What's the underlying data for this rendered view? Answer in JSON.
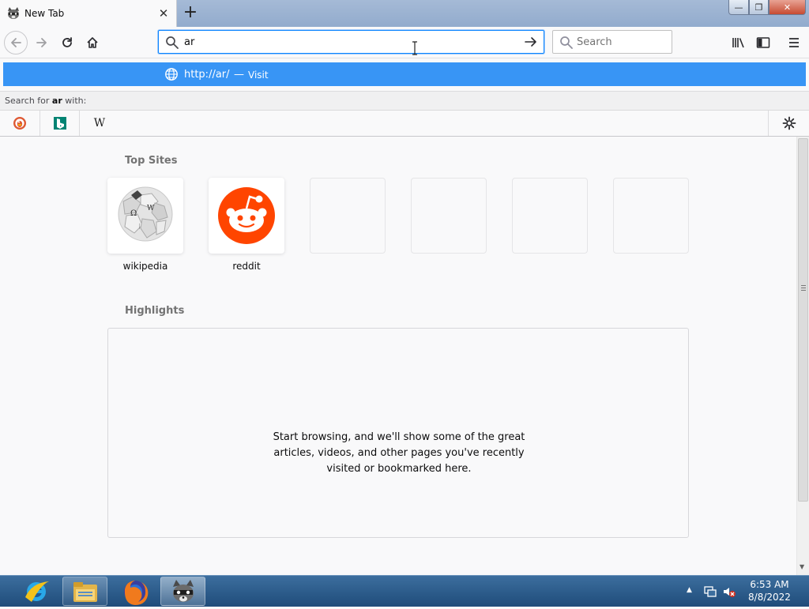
{
  "tab": {
    "title": "New Tab",
    "close_glyph": "✕",
    "favicon": "raccoon-icon"
  },
  "new_tab_glyph": "+",
  "window_controls": {
    "minimize": "—",
    "restore": "❐",
    "close": "✕"
  },
  "urlbar": {
    "value": "ar"
  },
  "searchbar": {
    "placeholder": "Search"
  },
  "suggestion": {
    "url": "http://ar/",
    "separator": "—",
    "action": "Visit"
  },
  "oneoff": {
    "prefix": "Search for ",
    "query": "ar",
    "suffix": " with:",
    "engines": [
      {
        "name": "duckduckgo-icon"
      },
      {
        "name": "bing-icon",
        "letter": "b"
      },
      {
        "name": "wikipedia-icon",
        "letter": "W"
      }
    ]
  },
  "content": {
    "top_sites_title": "Top Sites",
    "top_sites": [
      {
        "label": "wikipedia"
      },
      {
        "label": "reddit"
      }
    ],
    "highlights_title": "Highlights",
    "highlights_message": "Start browsing, and we'll show some of the great articles, videos, and other pages you've recently visited or bookmarked here."
  },
  "taskbar": {
    "apps": [
      "internet-explorer-icon",
      "file-explorer-icon",
      "firefox-icon",
      "raccoon-app-icon"
    ],
    "time": "6:53 AM",
    "date": "8/8/2022"
  },
  "colors": {
    "accent": "#0a84ff",
    "suggestion_bg": "#3895f5",
    "reddit": "#ff4500",
    "taskbar": "#2a5a88"
  }
}
